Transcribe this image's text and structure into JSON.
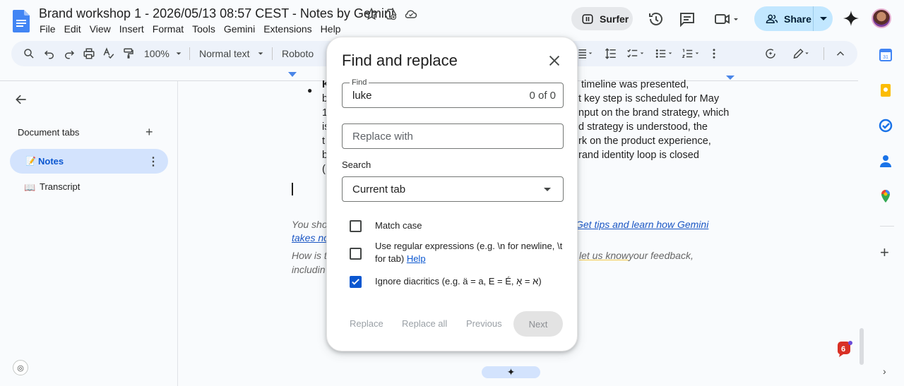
{
  "document": {
    "title": "Brand workshop 1 - 2026/05/13 08:57 CEST - Notes by Gemini"
  },
  "menu": [
    "File",
    "Edit",
    "View",
    "Insert",
    "Format",
    "Tools",
    "Gemini",
    "Extensions",
    "Help"
  ],
  "header": {
    "surfer_label": "Surfer",
    "share_label": "Share"
  },
  "toolbar": {
    "zoom": "100%",
    "style": "Normal text",
    "font": "Roboto"
  },
  "sidebar": {
    "section_label": "Document tabs",
    "tabs": [
      {
        "emoji": "📝",
        "label": "Notes",
        "selected": true
      },
      {
        "emoji": "📖",
        "label": "Transcript",
        "selected": false
      }
    ]
  },
  "doc": {
    "lines_left": [
      "b",
      "1",
      "is",
      "t",
      "b",
      "("
    ],
    "lines_right": [
      "timeline was presented,",
      "t key step is scheduled for May",
      "nput on the brand strategy, which",
      "d strategy is understood, the",
      "rk on the product experience,",
      "rand identity loop is closed"
    ],
    "bullet_prefix": "K",
    "footer_line1_left": "You sho",
    "footer_line1_link": "Get tips and learn how Gemini",
    "footer_line2_link": "takes no",
    "footer_line3_left": "How is t",
    "footer_line3_link": "let us know",
    "footer_line3_right": " your feedback,",
    "footer_line4_left": "includin"
  },
  "notification_count": "6",
  "dialog": {
    "title": "Find and replace",
    "find_label": "Find",
    "find_value": "luke",
    "find_count": "0 of 0",
    "replace_placeholder": "Replace with",
    "search_label": "Search",
    "search_value": "Current tab",
    "options": [
      {
        "label": "Match case",
        "checked": false
      },
      {
        "label": "Use regular expressions (e.g. \\n for newline, \\t",
        "label2": "for tab)",
        "help": "Help",
        "checked": false
      },
      {
        "label": "Ignore diacritics (e.g. ä = a, E = É, א = אָ)",
        "checked": true
      }
    ],
    "buttons": {
      "replace": "Replace",
      "replace_all": "Replace all",
      "previous": "Previous",
      "next": "Next"
    }
  },
  "colors": {
    "accent": "#0b57d0",
    "share_bg": "#c2e7ff",
    "selected_tab_bg": "#d3e3fd"
  }
}
